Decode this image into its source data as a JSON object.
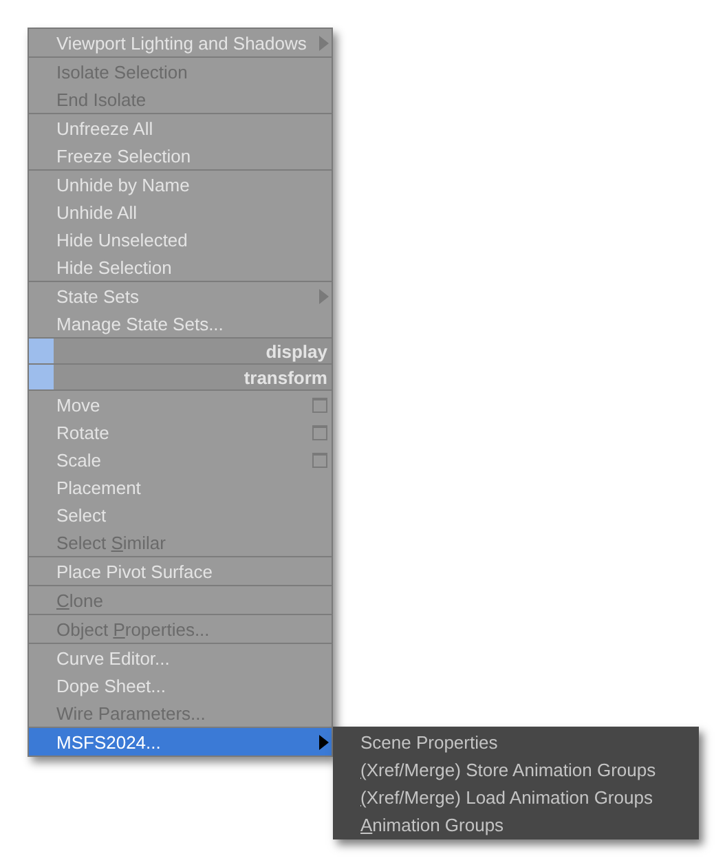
{
  "menu": {
    "groups": [
      {
        "items": [
          {
            "kind": "item",
            "label": "Viewport Lighting and Shadows",
            "disabled": false,
            "submenu": true,
            "selected": false
          }
        ]
      },
      {
        "items": [
          {
            "kind": "item",
            "label": "Isolate Selection",
            "disabled": true,
            "selected": false
          },
          {
            "kind": "item",
            "label": "End Isolate",
            "disabled": true,
            "selected": false
          }
        ]
      },
      {
        "items": [
          {
            "kind": "item",
            "label": "Unfreeze All",
            "disabled": false,
            "selected": false
          },
          {
            "kind": "item",
            "label": "Freeze Selection",
            "disabled": false,
            "selected": false
          }
        ]
      },
      {
        "items": [
          {
            "kind": "item",
            "label": "Unhide by Name",
            "disabled": false,
            "selected": false
          },
          {
            "kind": "item",
            "label": "Unhide All",
            "disabled": false,
            "selected": false
          },
          {
            "kind": "item",
            "label": "Hide Unselected",
            "disabled": false,
            "selected": false
          },
          {
            "kind": "item",
            "label": "Hide Selection",
            "disabled": false,
            "selected": false
          }
        ]
      },
      {
        "items": [
          {
            "kind": "item",
            "label": "State Sets",
            "disabled": false,
            "submenu": true,
            "selected": false
          },
          {
            "kind": "item",
            "label": "Manage State Sets...",
            "disabled": false,
            "selected": false
          }
        ]
      },
      {
        "items": [
          {
            "kind": "header",
            "label": "display"
          }
        ]
      },
      {
        "items": [
          {
            "kind": "header",
            "label": "transform"
          }
        ]
      },
      {
        "items": [
          {
            "kind": "item",
            "label": "Move",
            "disabled": false,
            "option_box": true,
            "selected": false
          },
          {
            "kind": "item",
            "label": "Rotate",
            "disabled": false,
            "option_box": true,
            "selected": false
          },
          {
            "kind": "item",
            "label": "Scale",
            "disabled": false,
            "option_box": true,
            "selected": false
          },
          {
            "kind": "item",
            "label": "Placement",
            "disabled": false,
            "selected": false
          },
          {
            "kind": "item",
            "label": "Select",
            "disabled": false,
            "selected": false
          },
          {
            "kind": "item",
            "label_before": "Select ",
            "label_key": "S",
            "label_after": "imilar",
            "disabled": true,
            "selected": false
          }
        ]
      },
      {
        "items": [
          {
            "kind": "item",
            "label": "Place Pivot Surface",
            "disabled": false,
            "selected": false
          }
        ]
      },
      {
        "items": [
          {
            "kind": "item",
            "label_key": "C",
            "label_after": "lone",
            "disabled": true,
            "selected": false
          }
        ]
      },
      {
        "items": [
          {
            "kind": "item",
            "label_before": "Object ",
            "label_key": "P",
            "label_after": "roperties...",
            "disabled": true,
            "selected": false
          }
        ]
      },
      {
        "items": [
          {
            "kind": "item",
            "label": "Curve Editor...",
            "disabled": false,
            "selected": false
          },
          {
            "kind": "item",
            "label": "Dope Sheet...",
            "disabled": false,
            "selected": false
          },
          {
            "kind": "item",
            "label": "Wire Parameters...",
            "disabled": true,
            "selected": false
          }
        ]
      },
      {
        "items": [
          {
            "kind": "item",
            "label": "MSFS2024...",
            "disabled": false,
            "submenu": true,
            "selected": true
          }
        ]
      }
    ]
  },
  "submenu": {
    "items": [
      {
        "label": "Scene Properties"
      },
      {
        "label_key": "(",
        "label_after": "Xref/Merge) Store Animation Groups"
      },
      {
        "label_key": "(",
        "label_after": "Xref/Merge) Load Animation Groups"
      },
      {
        "label_key": "A",
        "label_after": "nimation Groups"
      }
    ]
  }
}
